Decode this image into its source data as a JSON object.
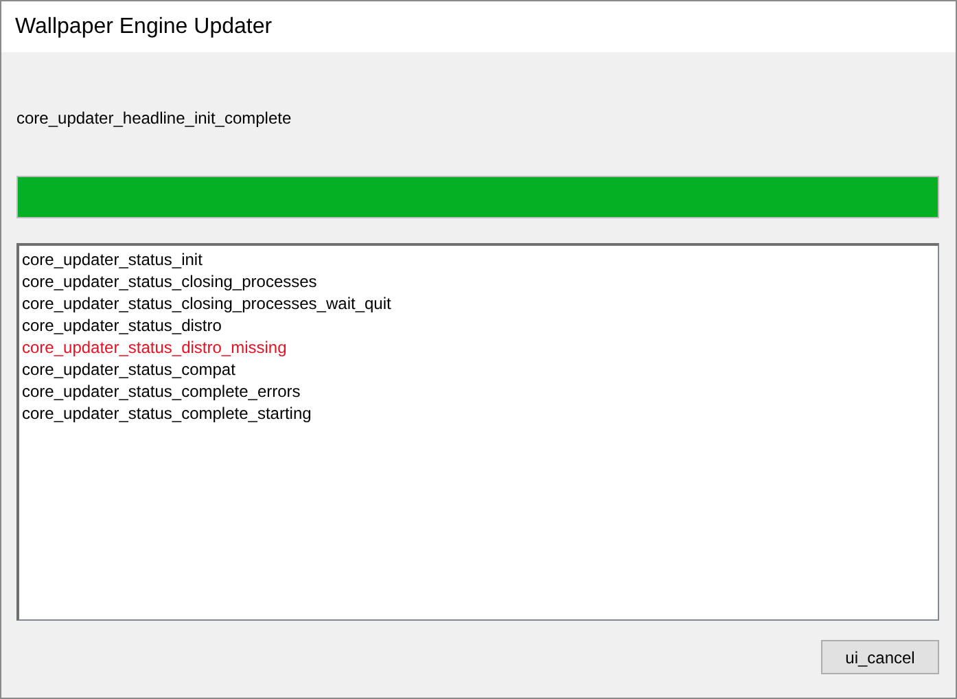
{
  "window": {
    "title": "Wallpaper Engine Updater"
  },
  "headline": "core_updater_headline_init_complete",
  "progress": {
    "level": 1
  },
  "log": [
    {
      "text": "core_updater_status_init",
      "kind": "info"
    },
    {
      "text": "core_updater_status_closing_processes",
      "kind": "info"
    },
    {
      "text": "core_updater_status_closing_processes_wait_quit",
      "kind": "info"
    },
    {
      "text": "core_updater_status_distro",
      "kind": "info"
    },
    {
      "text": "core_updater_status_distro_missing",
      "kind": "error"
    },
    {
      "text": "core_updater_status_compat",
      "kind": "info"
    },
    {
      "text": "core_updater_status_complete_errors",
      "kind": "info"
    },
    {
      "text": "core_updater_status_complete_starting",
      "kind": "info"
    }
  ],
  "buttons": [
    "ui_cancel"
  ]
}
